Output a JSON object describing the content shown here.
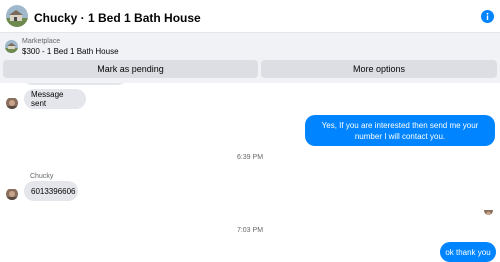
{
  "header": {
    "title": "Chucky · 1 Bed 1 Bath House",
    "info_icon": "info-icon"
  },
  "marketplace": {
    "label": "Marketplace",
    "listing": "$300 - 1 Bed 1 Bath House"
  },
  "actions": {
    "pending_label": "Mark as pending",
    "more_label": "More options"
  },
  "messages": [
    {
      "direction": "in",
      "text": "Message sent"
    },
    {
      "direction": "out",
      "text": "Yes, If you are interested then send me your number I will contact you."
    },
    {
      "type": "timestamp",
      "text": "6:39 PM"
    },
    {
      "direction": "in",
      "sender": "Chucky",
      "text": "6013396606"
    },
    {
      "type": "timestamp",
      "text": "7:03 PM"
    },
    {
      "direction": "out",
      "text": "ok thank you"
    }
  ],
  "colors": {
    "outgoing_bubble": "#0084ff",
    "incoming_bubble": "#e4e6eb",
    "action_button": "#dcdee3",
    "panel_background": "#f0f2f5"
  }
}
